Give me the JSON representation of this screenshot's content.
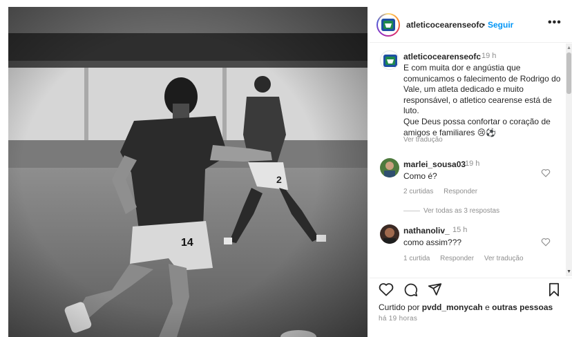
{
  "post": {
    "username": "atleticocearenseofc",
    "dot": "•",
    "follow_label": "Seguir",
    "more_label": "•••"
  },
  "caption": {
    "username": "atleticocearenseofc",
    "time": "19 h",
    "text": "E com muita dor e angústia que comunicamos o falecimento de Rodrigo do Vale, um atleta dedicado e muito responsável, o atletico cearense está de luto.\nQue Deus possa confortar o coração de amigos e familiares 😢⚽",
    "translate": "Ver tradução"
  },
  "comments": [
    {
      "username": "marlei_sousa03",
      "time": "19 h",
      "text": "Como é?",
      "likes": "2 curtidas",
      "reply": "Responder",
      "view_replies": "Ver todas as 3 respostas"
    },
    {
      "username": "nathanoliv_",
      "time": "15 h",
      "text": "como assim???",
      "likes": "1 curtida",
      "reply": "Responder",
      "translate": "Ver tradução"
    }
  ],
  "liked_by": {
    "prefix": "Curtido por",
    "user": "pvdd_monycah",
    "conj": "e",
    "others": "outras pessoas"
  },
  "time_ago": "há 19 horas",
  "photo": {
    "player_number": "14",
    "back_player_number": "2"
  },
  "colors": {
    "link_blue": "#0095f6",
    "text": "#262626",
    "muted": "#8e8e8e",
    "crest_green": "#1f8a4c",
    "crest_blue": "#1e4fa3"
  },
  "icons": [
    "more-icon",
    "heart-icon",
    "comment-icon",
    "share-icon",
    "save-icon",
    "small-heart-icon",
    "scroll-up-arrow",
    "scroll-down-arrow"
  ]
}
